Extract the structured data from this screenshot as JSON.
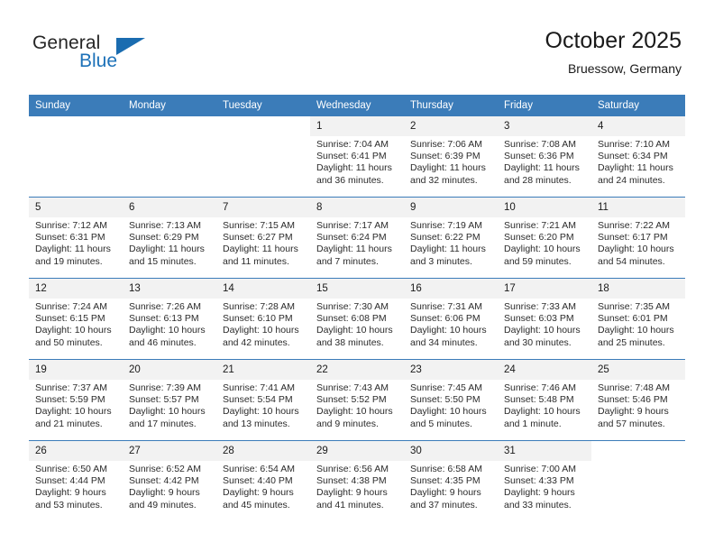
{
  "brand": {
    "name_top": "General",
    "name_bottom": "Blue",
    "flag_icon": "triangle-flag-icon",
    "accent_color": "#1a6cb0"
  },
  "header": {
    "title": "October 2025",
    "location": "Bruessow, Germany"
  },
  "theme": {
    "header_blue": "#3b7cb9",
    "daynum_gray": "#f2f2f2",
    "text": "#1a1a1a"
  },
  "calendar": {
    "weekday_headers": [
      "Sunday",
      "Monday",
      "Tuesday",
      "Wednesday",
      "Thursday",
      "Friday",
      "Saturday"
    ],
    "weeks": [
      [
        {
          "day": "",
          "lines": []
        },
        {
          "day": "",
          "lines": []
        },
        {
          "day": "",
          "lines": []
        },
        {
          "day": "1",
          "lines": [
            "Sunrise: 7:04 AM",
            "Sunset: 6:41 PM",
            "Daylight: 11 hours",
            "and 36 minutes."
          ]
        },
        {
          "day": "2",
          "lines": [
            "Sunrise: 7:06 AM",
            "Sunset: 6:39 PM",
            "Daylight: 11 hours",
            "and 32 minutes."
          ]
        },
        {
          "day": "3",
          "lines": [
            "Sunrise: 7:08 AM",
            "Sunset: 6:36 PM",
            "Daylight: 11 hours",
            "and 28 minutes."
          ]
        },
        {
          "day": "4",
          "lines": [
            "Sunrise: 7:10 AM",
            "Sunset: 6:34 PM",
            "Daylight: 11 hours",
            "and 24 minutes."
          ]
        }
      ],
      [
        {
          "day": "5",
          "lines": [
            "Sunrise: 7:12 AM",
            "Sunset: 6:31 PM",
            "Daylight: 11 hours",
            "and 19 minutes."
          ]
        },
        {
          "day": "6",
          "lines": [
            "Sunrise: 7:13 AM",
            "Sunset: 6:29 PM",
            "Daylight: 11 hours",
            "and 15 minutes."
          ]
        },
        {
          "day": "7",
          "lines": [
            "Sunrise: 7:15 AM",
            "Sunset: 6:27 PM",
            "Daylight: 11 hours",
            "and 11 minutes."
          ]
        },
        {
          "day": "8",
          "lines": [
            "Sunrise: 7:17 AM",
            "Sunset: 6:24 PM",
            "Daylight: 11 hours",
            "and 7 minutes."
          ]
        },
        {
          "day": "9",
          "lines": [
            "Sunrise: 7:19 AM",
            "Sunset: 6:22 PM",
            "Daylight: 11 hours",
            "and 3 minutes."
          ]
        },
        {
          "day": "10",
          "lines": [
            "Sunrise: 7:21 AM",
            "Sunset: 6:20 PM",
            "Daylight: 10 hours",
            "and 59 minutes."
          ]
        },
        {
          "day": "11",
          "lines": [
            "Sunrise: 7:22 AM",
            "Sunset: 6:17 PM",
            "Daylight: 10 hours",
            "and 54 minutes."
          ]
        }
      ],
      [
        {
          "day": "12",
          "lines": [
            "Sunrise: 7:24 AM",
            "Sunset: 6:15 PM",
            "Daylight: 10 hours",
            "and 50 minutes."
          ]
        },
        {
          "day": "13",
          "lines": [
            "Sunrise: 7:26 AM",
            "Sunset: 6:13 PM",
            "Daylight: 10 hours",
            "and 46 minutes."
          ]
        },
        {
          "day": "14",
          "lines": [
            "Sunrise: 7:28 AM",
            "Sunset: 6:10 PM",
            "Daylight: 10 hours",
            "and 42 minutes."
          ]
        },
        {
          "day": "15",
          "lines": [
            "Sunrise: 7:30 AM",
            "Sunset: 6:08 PM",
            "Daylight: 10 hours",
            "and 38 minutes."
          ]
        },
        {
          "day": "16",
          "lines": [
            "Sunrise: 7:31 AM",
            "Sunset: 6:06 PM",
            "Daylight: 10 hours",
            "and 34 minutes."
          ]
        },
        {
          "day": "17",
          "lines": [
            "Sunrise: 7:33 AM",
            "Sunset: 6:03 PM",
            "Daylight: 10 hours",
            "and 30 minutes."
          ]
        },
        {
          "day": "18",
          "lines": [
            "Sunrise: 7:35 AM",
            "Sunset: 6:01 PM",
            "Daylight: 10 hours",
            "and 25 minutes."
          ]
        }
      ],
      [
        {
          "day": "19",
          "lines": [
            "Sunrise: 7:37 AM",
            "Sunset: 5:59 PM",
            "Daylight: 10 hours",
            "and 21 minutes."
          ]
        },
        {
          "day": "20",
          "lines": [
            "Sunrise: 7:39 AM",
            "Sunset: 5:57 PM",
            "Daylight: 10 hours",
            "and 17 minutes."
          ]
        },
        {
          "day": "21",
          "lines": [
            "Sunrise: 7:41 AM",
            "Sunset: 5:54 PM",
            "Daylight: 10 hours",
            "and 13 minutes."
          ]
        },
        {
          "day": "22",
          "lines": [
            "Sunrise: 7:43 AM",
            "Sunset: 5:52 PM",
            "Daylight: 10 hours",
            "and 9 minutes."
          ]
        },
        {
          "day": "23",
          "lines": [
            "Sunrise: 7:45 AM",
            "Sunset: 5:50 PM",
            "Daylight: 10 hours",
            "and 5 minutes."
          ]
        },
        {
          "day": "24",
          "lines": [
            "Sunrise: 7:46 AM",
            "Sunset: 5:48 PM",
            "Daylight: 10 hours",
            "and 1 minute."
          ]
        },
        {
          "day": "25",
          "lines": [
            "Sunrise: 7:48 AM",
            "Sunset: 5:46 PM",
            "Daylight: 9 hours",
            "and 57 minutes."
          ]
        }
      ],
      [
        {
          "day": "26",
          "lines": [
            "Sunrise: 6:50 AM",
            "Sunset: 4:44 PM",
            "Daylight: 9 hours",
            "and 53 minutes."
          ]
        },
        {
          "day": "27",
          "lines": [
            "Sunrise: 6:52 AM",
            "Sunset: 4:42 PM",
            "Daylight: 9 hours",
            "and 49 minutes."
          ]
        },
        {
          "day": "28",
          "lines": [
            "Sunrise: 6:54 AM",
            "Sunset: 4:40 PM",
            "Daylight: 9 hours",
            "and 45 minutes."
          ]
        },
        {
          "day": "29",
          "lines": [
            "Sunrise: 6:56 AM",
            "Sunset: 4:38 PM",
            "Daylight: 9 hours",
            "and 41 minutes."
          ]
        },
        {
          "day": "30",
          "lines": [
            "Sunrise: 6:58 AM",
            "Sunset: 4:35 PM",
            "Daylight: 9 hours",
            "and 37 minutes."
          ]
        },
        {
          "day": "31",
          "lines": [
            "Sunrise: 7:00 AM",
            "Sunset: 4:33 PM",
            "Daylight: 9 hours",
            "and 33 minutes."
          ]
        },
        {
          "day": "",
          "lines": []
        }
      ]
    ]
  }
}
